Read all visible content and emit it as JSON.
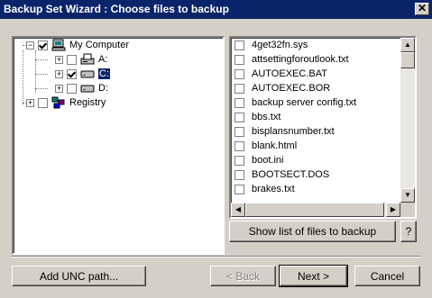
{
  "window": {
    "title": "Backup Set Wizard : Choose files to backup",
    "close_glyph": "✕"
  },
  "tree": {
    "items": [
      {
        "label": "My Computer",
        "checked": true
      },
      {
        "label": "A:",
        "checked": false
      },
      {
        "label": "C:",
        "checked": true,
        "selected": true
      },
      {
        "label": "D:",
        "checked": false
      },
      {
        "label": "Registry",
        "checked": false
      }
    ]
  },
  "files": {
    "items": [
      "4get32fn.sys",
      "attsettingforoutlook.txt",
      "AUTOEXEC.BAT",
      "AUTOEXEC.BOR",
      "backup server config.txt",
      "bbs.txt",
      "bisplansnumber.txt",
      "blank.html",
      "boot.ini",
      "BOOTSECT.DOS",
      "brakes.txt"
    ]
  },
  "buttons": {
    "show_list": "Show list of files to backup",
    "help": "?",
    "add_unc": "Add UNC path...",
    "back": "< Back",
    "next": "Next >",
    "cancel": "Cancel"
  },
  "colors": {
    "title_bar": "#0a246a",
    "face": "#d4d0c8",
    "selection": "#0a246a"
  }
}
